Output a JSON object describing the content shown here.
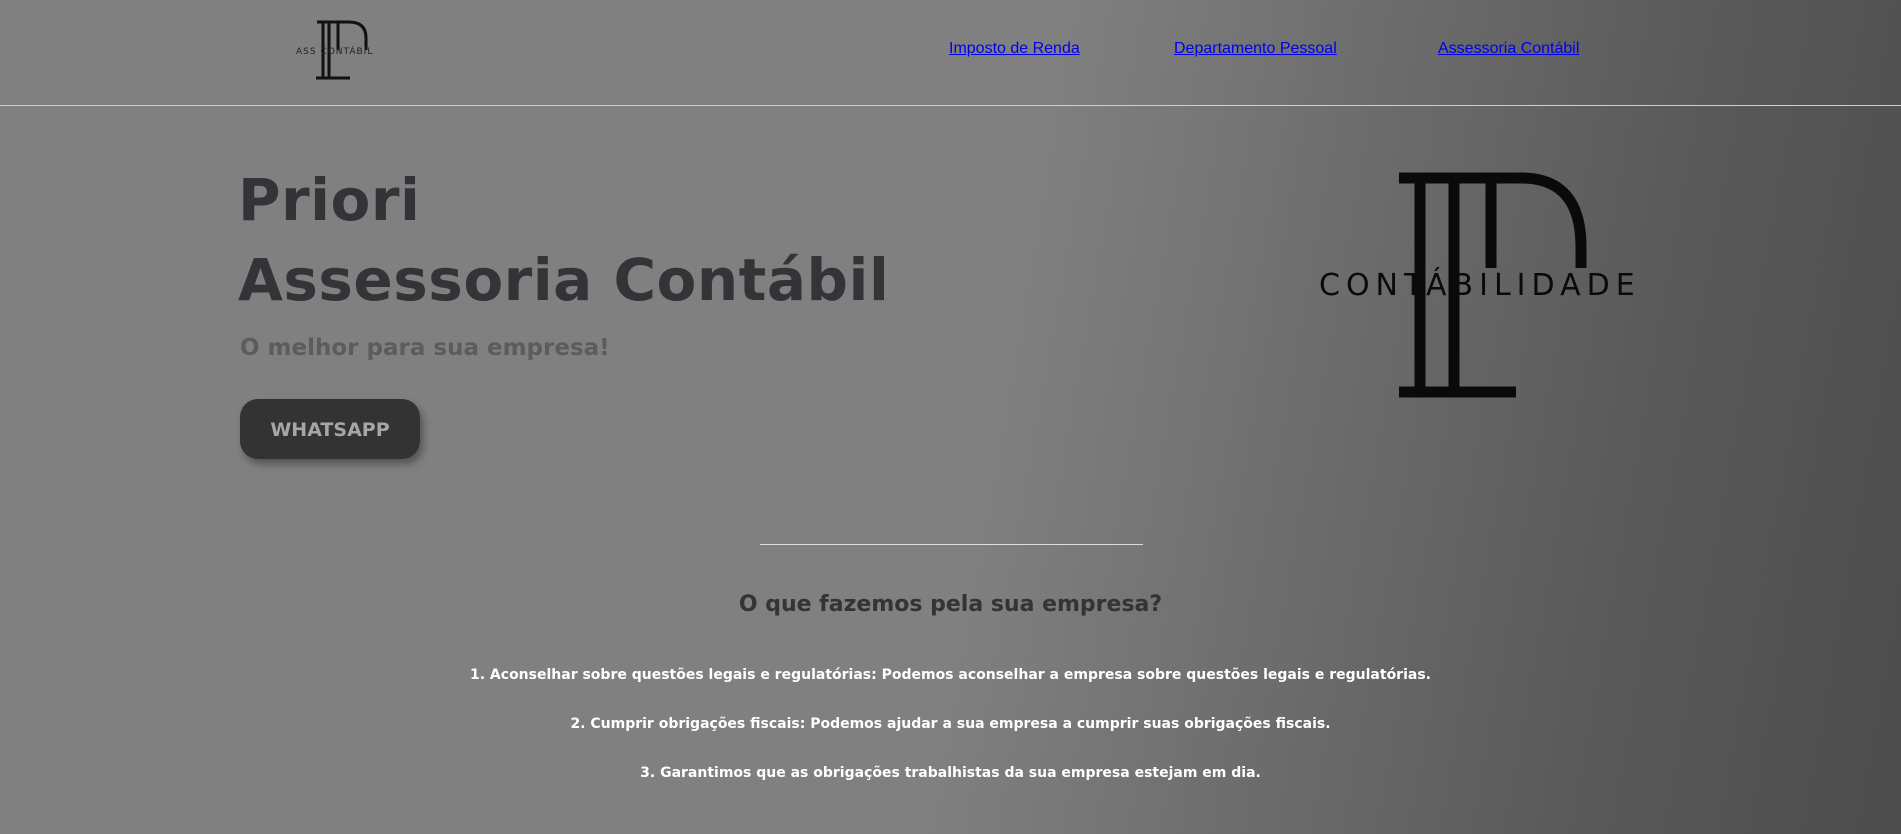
{
  "header": {
    "logo": {
      "text": "ASS CONTÁBIL",
      "icon": "priori-monogram-logo"
    },
    "nav": [
      {
        "label": "Imposto de Renda"
      },
      {
        "label": "Departamento Pessoal"
      },
      {
        "label": "Assessoria Contábil"
      }
    ]
  },
  "hero": {
    "title_line1": "Priori",
    "title_line2": "Assessoria Contábil",
    "subtitle": "O melhor para sua empresa!",
    "cta_label": "WHATSAPP",
    "logo": {
      "text": "CONTÁBILIDADE",
      "icon": "priori-monogram-logo"
    }
  },
  "services": {
    "heading": "O que fazemos pela sua empresa?",
    "items": [
      "1. Aconselhar sobre questões legais e regulatórias: Podemos aconselhar a empresa sobre questões legais e regulatórias.",
      "2. Cumprir obrigações fiscais: Podemos ajudar a sua empresa a cumprir suas obrigações fiscais.",
      "3. Garantimos que as obrigações trabalhistas da sua empresa estejam em dia."
    ]
  },
  "colors": {
    "background_left": "#808080",
    "background_right": "#4d4d4d",
    "title_text": "#333338",
    "button_bg": "#333333",
    "button_text": "#a6a6a6",
    "nav_text": "#ffffff"
  }
}
